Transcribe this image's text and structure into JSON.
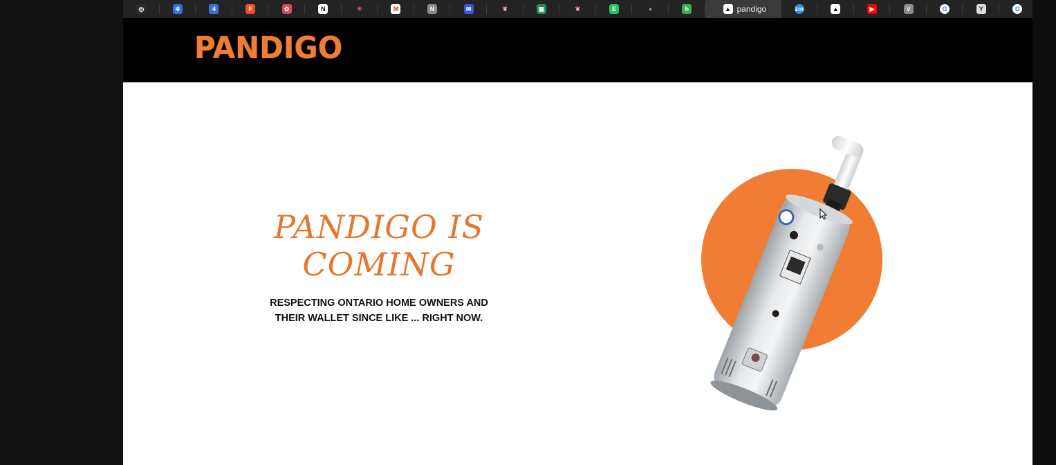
{
  "browser": {
    "tabs": [
      {
        "icon": "chatgpt-icon",
        "glyph": "◎",
        "color": "#2b2b2b",
        "fg": "#ffffff"
      },
      {
        "icon": "kubernetes-icon",
        "glyph": "✲",
        "color": "#326ce5",
        "fg": "#ffffff"
      },
      {
        "icon": "four-app-icon",
        "glyph": "4",
        "color": "#3b6fd8",
        "fg": "#ffffff"
      },
      {
        "icon": "figma-icon",
        "glyph": "F",
        "color": "#f24e1e",
        "fg": "#ffffff"
      },
      {
        "icon": "design-app-icon",
        "glyph": "✿",
        "color": "#d9485a",
        "fg": "#ffffff"
      },
      {
        "icon": "notion-icon",
        "glyph": "N",
        "color": "#ffffff",
        "fg": "#111111"
      },
      {
        "icon": "asterisk-app-icon",
        "glyph": "✳",
        "color": "#232323",
        "fg": "#e0529c"
      },
      {
        "icon": "gmail-icon",
        "glyph": "M",
        "color": "#ffffff",
        "fg": "#d93025"
      },
      {
        "icon": "n-app-icon",
        "glyph": "N",
        "color": "#8a8a8a",
        "fg": "#ffffff"
      },
      {
        "icon": "mail-app-icon",
        "glyph": "✉",
        "color": "#3a5bd9",
        "fg": "#ffffff"
      },
      {
        "icon": "brain-app-icon",
        "glyph": "❦",
        "color": "#232323",
        "fg": "#f2a6b8"
      },
      {
        "icon": "sheet-app-icon",
        "glyph": "▣",
        "color": "#1f8f5a",
        "fg": "#ffffff"
      },
      {
        "icon": "brain-app-icon-2",
        "glyph": "❦",
        "color": "#232323",
        "fg": "#f2a6b8"
      },
      {
        "icon": "evernote-icon",
        "glyph": "E",
        "color": "#2dbe60",
        "fg": "#ffffff"
      },
      {
        "icon": "creature-app-icon",
        "glyph": "●",
        "color": "#232323",
        "fg": "#c08a4a"
      },
      {
        "icon": "h-app-icon",
        "glyph": "h",
        "color": "#3fae49",
        "fg": "#ffffff"
      },
      {
        "icon": "pandigo-tab-icon",
        "glyph": "▲",
        "color": "#ffffff",
        "fg": "#111111",
        "title": "pandigo",
        "active": true
      },
      {
        "icon": "zoom-icon",
        "glyph": "zm",
        "color": "#2d8cff",
        "fg": "#ffffff"
      },
      {
        "icon": "triangle-app-icon",
        "glyph": "▲",
        "color": "#ffffff",
        "fg": "#111111"
      },
      {
        "icon": "youtube-icon",
        "glyph": "▶",
        "color": "#ff0000",
        "fg": "#ffffff"
      },
      {
        "icon": "v-app-icon",
        "glyph": "V",
        "color": "#8a8a8a",
        "fg": "#ffffff"
      },
      {
        "icon": "google-icon",
        "glyph": "G",
        "color": "#ffffff",
        "fg": "#4285f4"
      },
      {
        "icon": "y-app-icon",
        "glyph": "Y",
        "color": "#dddddd",
        "fg": "#222222"
      },
      {
        "icon": "google-icon-2",
        "glyph": "G",
        "color": "#ffffff",
        "fg": "#4285f4"
      }
    ]
  },
  "site": {
    "logo": "PANDIGO",
    "accent": "#f07d33"
  },
  "hero": {
    "title": "PANDIGO IS COMING",
    "subtitle_line1": "RESPECTING ONTARIO HOME OWNERS AND",
    "subtitle_line2": "THEIR WALLET SINCE LIKE ... RIGHT NOW.",
    "image_icon": "water-heater-icon",
    "circle_color": "#f07d33"
  }
}
